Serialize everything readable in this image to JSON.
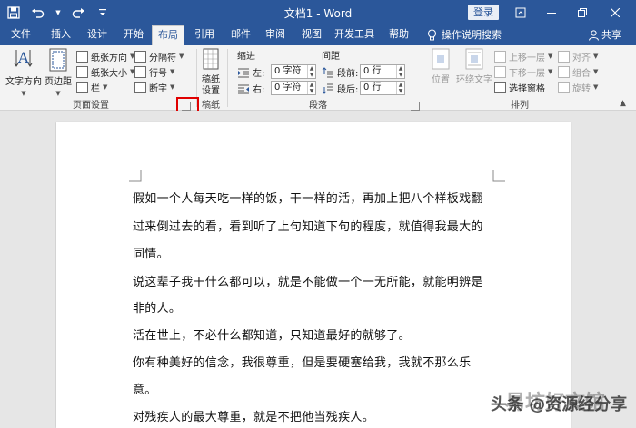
{
  "window": {
    "title": "文档1 - Word",
    "login_label": "登录"
  },
  "tabs": [
    {
      "label": "文件"
    },
    {
      "label": "插入"
    },
    {
      "label": "设计"
    },
    {
      "label": "开始"
    },
    {
      "label": "布局"
    },
    {
      "label": "引用"
    },
    {
      "label": "邮件"
    },
    {
      "label": "审阅"
    },
    {
      "label": "视图"
    },
    {
      "label": "开发工具"
    },
    {
      "label": "帮助"
    }
  ],
  "tell_me": "操作说明搜索",
  "share_label": "共享",
  "ribbon": {
    "page_setup": {
      "label": "页面设置",
      "text_direction": "文字方向",
      "margins": "页边距",
      "orientation": "纸张方向",
      "size": "纸张大小",
      "columns": "栏",
      "breaks": "分隔符",
      "line_numbers": "行号",
      "hyphenation": "断字"
    },
    "manuscript": {
      "label": "稿纸",
      "settings_line1": "稿纸",
      "settings_line2": "设置"
    },
    "paragraph": {
      "label": "段落",
      "indent": "缩进",
      "spacing": "间距",
      "left": "左:",
      "right": "右:",
      "left_value": "0 字符",
      "right_value": "0 字符",
      "before": "段前:",
      "after": "段后:",
      "before_value": "0 行",
      "after_value": "0 行"
    },
    "arrange": {
      "label": "排列",
      "position": "位置",
      "wrap_text": "环绕文字",
      "bring_forward": "上移一层",
      "send_backward": "下移一层",
      "selection_pane": "选择窗格",
      "align": "对齐",
      "group": "组合",
      "rotate": "旋转"
    }
  },
  "document": {
    "lines": [
      "假如一个人每天吃一样的饭，干一样的活，再加上把八个样板戏翻",
      "过来倒过去的看，看到听了上句知道下句的程度，就值得我最大的",
      "同情。",
      "说这辈子我干什么都可以，就是不能做一个一无所能，就能明辨是",
      "非的人。",
      "活在世上，不必什么都知道，只知道最好的就够了。",
      "你有种美好的信念，我很尊重，但是要硬塞给我，我就不那么乐",
      "意。",
      "对残疾人的最大尊重，就是不把他当残疾人。"
    ]
  },
  "watermark": {
    "primary": "头条 @资源经分享",
    "secondary": "易坊好文馆"
  },
  "colors": {
    "title_bar": "#2b579a",
    "ribbon": "#f3f3f3",
    "highlight_box": "#e00000"
  }
}
